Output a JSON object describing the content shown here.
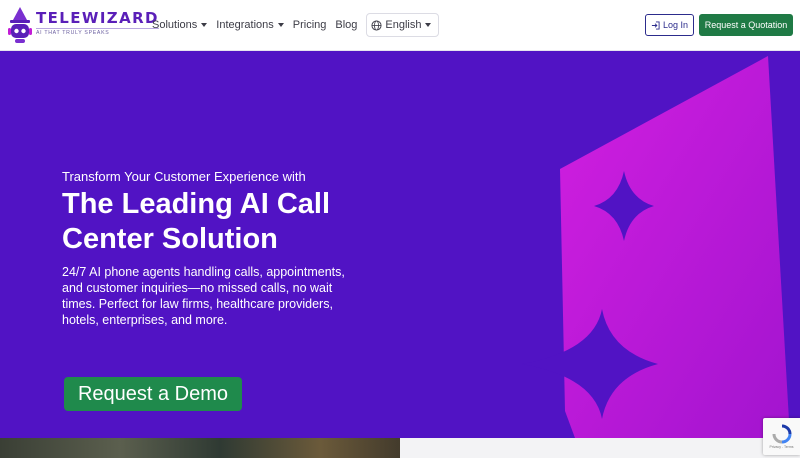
{
  "brand": {
    "name": "TELEWIZARD",
    "tagline": "AI THAT TRULY SPEAKS"
  },
  "nav": {
    "items": [
      {
        "label": "Solutions",
        "dropdown": true
      },
      {
        "label": "Integrations",
        "dropdown": true
      },
      {
        "label": "Pricing",
        "dropdown": false
      },
      {
        "label": "Blog",
        "dropdown": false
      }
    ],
    "language": "English",
    "login_label": "Log In",
    "quote_label": "Request a Quotation"
  },
  "hero": {
    "kicker": "Transform Your Customer Experience with",
    "title": "The Leading AI Call Center Solution",
    "description": "24/7 AI phone agents handling calls, appointments, and customer inquiries—no missed calls, no wait times. Perfect for law firms, healthcare providers, hotels, enterprises, and more.",
    "cta_label": "Request a Demo"
  },
  "recaptcha": {
    "footer": "Privacy - Terms"
  },
  "colors": {
    "brand_purple": "#5113c4",
    "accent_magenta": "#c21bd6",
    "cta_green": "#1f8a4c",
    "quote_green": "#1f7a45",
    "login_navy": "#2c2c8c"
  },
  "icons": {
    "logo": "wizard-robot-icon",
    "language": "globe-icon",
    "login": "sign-in-icon",
    "dropdown": "caret-down-icon",
    "recaptcha": "recaptcha-icon"
  }
}
